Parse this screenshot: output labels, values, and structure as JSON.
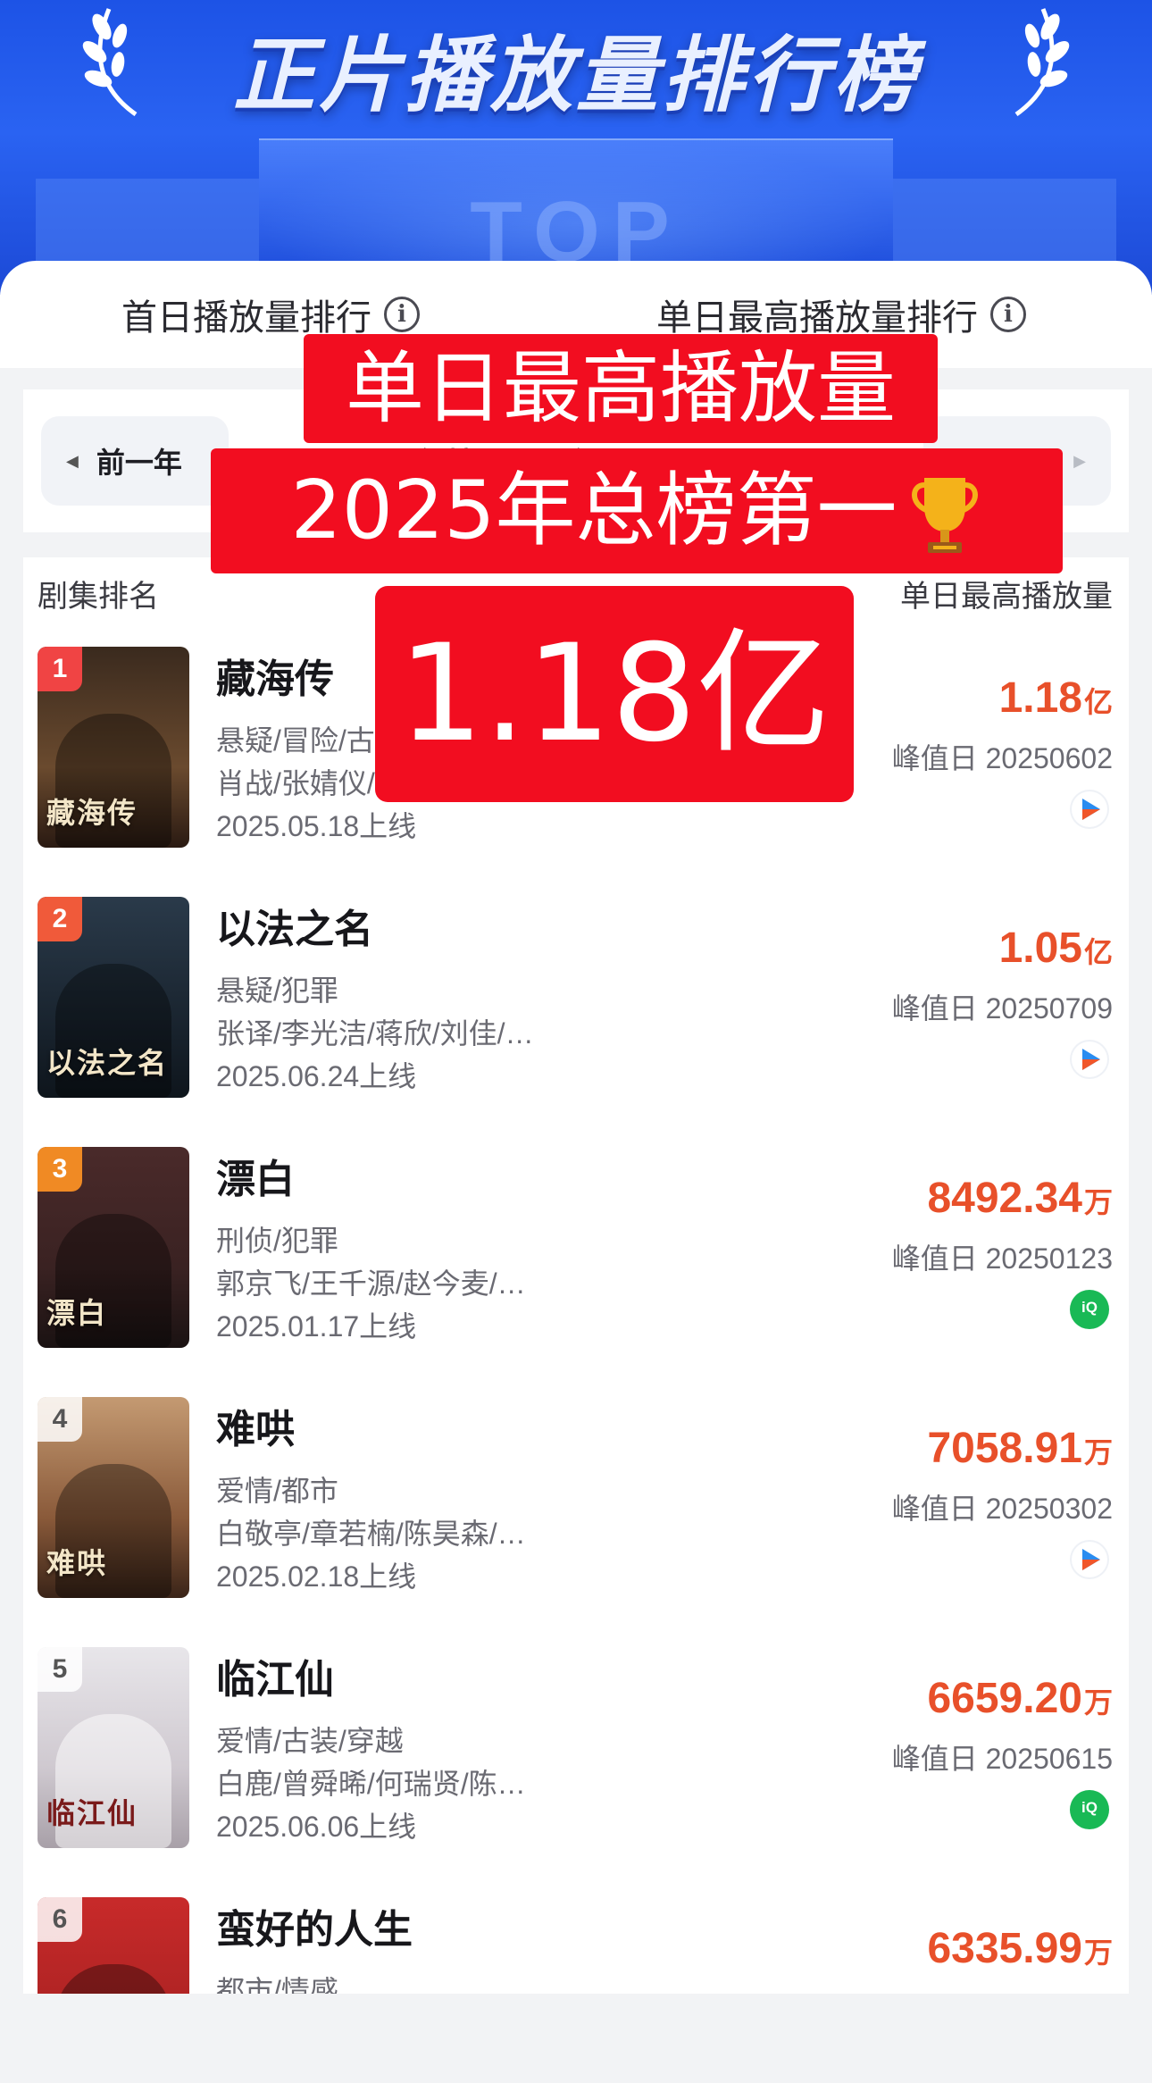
{
  "banner": {
    "title": "正片播放量排行榜",
    "stage_word": "TOP"
  },
  "tabs": [
    {
      "label": "首日播放量排行"
    },
    {
      "label": "单日最高播放量排行"
    }
  ],
  "year_selector": {
    "prev_label": "前一年",
    "current_label": "年榜 | 2025年"
  },
  "list_header": {
    "left": "剧集排名",
    "right": "单日最高播放量"
  },
  "items": [
    {
      "rank": "1",
      "title": "藏海传",
      "genre": "悬疑/冒险/古装",
      "cast": "肖战/张婧仪/黄觉/…",
      "date": "2025.05.18上线",
      "value": "1.18",
      "unit": "亿",
      "peak": "峰值日 20250602",
      "platform": "youku-icon",
      "poster_text": "藏海传",
      "poster_color": "#5a3a24"
    },
    {
      "rank": "2",
      "title": "以法之名",
      "genre": "悬疑/犯罪",
      "cast": "张译/李光洁/蒋欣/刘佳/…",
      "date": "2025.06.24上线",
      "value": "1.05",
      "unit": "亿",
      "peak": "峰值日 20250709",
      "platform": "youku-icon",
      "poster_text": "以法之名",
      "poster_color": "#1f2f3f"
    },
    {
      "rank": "3",
      "title": "漂白",
      "genre": "刑侦/犯罪",
      "cast": "郭京飞/王千源/赵今麦/…",
      "date": "2025.01.17上线",
      "value": "8492.34",
      "unit": "万",
      "peak": "峰值日 20250123",
      "platform": "iqiyi-icon",
      "poster_text": "漂白",
      "poster_color": "#3a2a2a"
    },
    {
      "rank": "4",
      "title": "难哄",
      "genre": "爱情/都市",
      "cast": "白敬亭/章若楠/陈昊森/…",
      "date": "2025.02.18上线",
      "value": "7058.91",
      "unit": "万",
      "peak": "峰值日 20250302",
      "platform": "youku-icon",
      "poster_text": "难哄",
      "poster_color": "#8a5a3a"
    },
    {
      "rank": "5",
      "title": "临江仙",
      "genre": "爱情/古装/穿越",
      "cast": "白鹿/曾舜晞/何瑞贤/陈…",
      "date": "2025.06.06上线",
      "value": "6659.20",
      "unit": "万",
      "peak": "峰值日 20250615",
      "platform": "iqiyi-icon",
      "poster_text": "临江仙",
      "poster_color": "#c8c8cc"
    },
    {
      "rank": "6",
      "title": "蛮好的人生",
      "genre": "都市/情感",
      "cast": "",
      "date": "",
      "value": "6335.99",
      "unit": "万",
      "peak": "",
      "platform": "",
      "poster_text": "",
      "poster_color": "#b82a2a"
    }
  ],
  "overlay": {
    "line1": "单日最高播放量",
    "line2": "2025年总榜第一",
    "line3": "1.18亿"
  },
  "colors": {
    "brand_blue": "#2a63f2",
    "value_orange": "#e8502a",
    "overlay_red": "#f20d20",
    "iqiyi_green": "#19b955"
  }
}
